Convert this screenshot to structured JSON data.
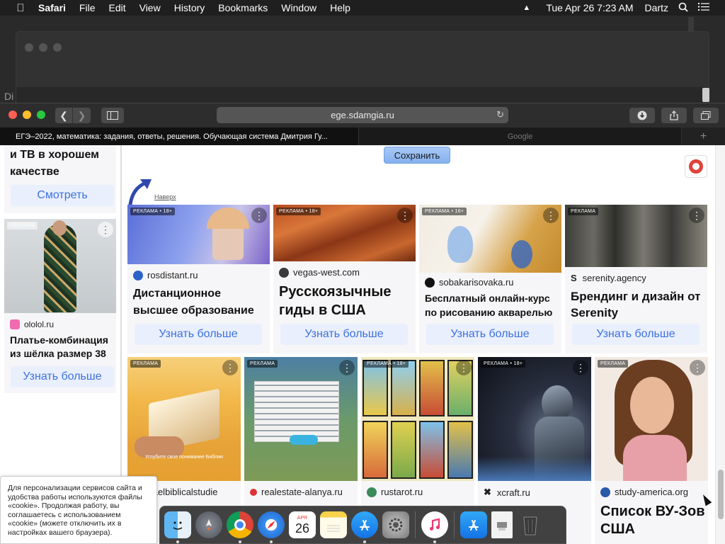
{
  "menubar": {
    "apple": "",
    "items": [
      "Safari",
      "File",
      "Edit",
      "View",
      "History",
      "Bookmarks",
      "Window",
      "Help"
    ],
    "datetime": "Tue Apr 26  7:23 AM",
    "user": "Dartz"
  },
  "background_window": {
    "partial_text": "Di"
  },
  "safari": {
    "url": "ege.sdamgia.ru",
    "tabs": [
      {
        "label": "ЕГЭ–2022, математика: задания, ответы, решения. Обучающая система Дмитрия Гу..."
      },
      {
        "label": "Google"
      }
    ],
    "new_tab": "+"
  },
  "page": {
    "save_button": "Сохранить",
    "back_to_top": "Наверх",
    "left_ads": [
      {
        "title": "и ТВ в хорошем качестве",
        "button": "Смотреть"
      },
      {
        "badge": "РЕКЛАМА",
        "source": "ololol.ru",
        "title": "Платье-комбинация из шёлка размер 38",
        "button": "Узнать больше"
      }
    ],
    "ads_row1": [
      {
        "badge": "РЕКЛАМА • 18+",
        "source": "rosdistant.ru",
        "title": "Дистанционное высшее образование",
        "button": "Узнать больше"
      },
      {
        "badge": "РЕКЛАМА • 18+",
        "source": "vegas-west.com",
        "title": "Русскоязычные гиды в США",
        "button": "Узнать больше"
      },
      {
        "badge": "РЕКЛАМА • 16+",
        "source": "sobakarisovaka.ru",
        "title": "Бесплатный онлайн-курс по рисованию акварелью",
        "button": "Узнать больше"
      },
      {
        "badge": "РЕКЛАМА",
        "source": "serenity.agency",
        "title": "Брендинг и дизайн от Serenity",
        "button": "Узнать больше"
      }
    ],
    "ads_row2": [
      {
        "badge": "РЕКЛАМА",
        "source": "israelbiblicalstudie",
        "image_caption": "Углубите свое понимание Библии"
      },
      {
        "badge": "РЕКЛАМА",
        "source": "realestate-alanya.ru"
      },
      {
        "badge": "РЕКЛАМА • 18+",
        "source": "rustarot.ru"
      },
      {
        "badge": "РЕКЛАМА • 18+",
        "source": "xcraft.ru"
      },
      {
        "badge": "РЕКЛАМА",
        "source": "study-america.org",
        "title": "Список ВУ-Зов США"
      }
    ],
    "cookie_notice": "Для персонализации сервисов сайта и удобства работы используются файлы «cookie». Продолжая работу, вы соглашаетесь с использованием «cookie» (можете отключить их в настройках вашего браузера)."
  },
  "dock": {
    "items": [
      "finder-icon",
      "launchpad-icon",
      "chrome-icon",
      "safari-icon",
      "calendar-icon",
      "notes-icon",
      "app-store-icon",
      "system-preferences-icon",
      "music-icon",
      "app-store-folder-icon",
      "document-icon",
      "trash-icon"
    ],
    "calendar": {
      "month": "APR",
      "day": "26"
    }
  },
  "colors": {
    "accent_blue": "#3d71df",
    "button_bg": "#e9effd",
    "card_bg": "#f6f6f8"
  }
}
